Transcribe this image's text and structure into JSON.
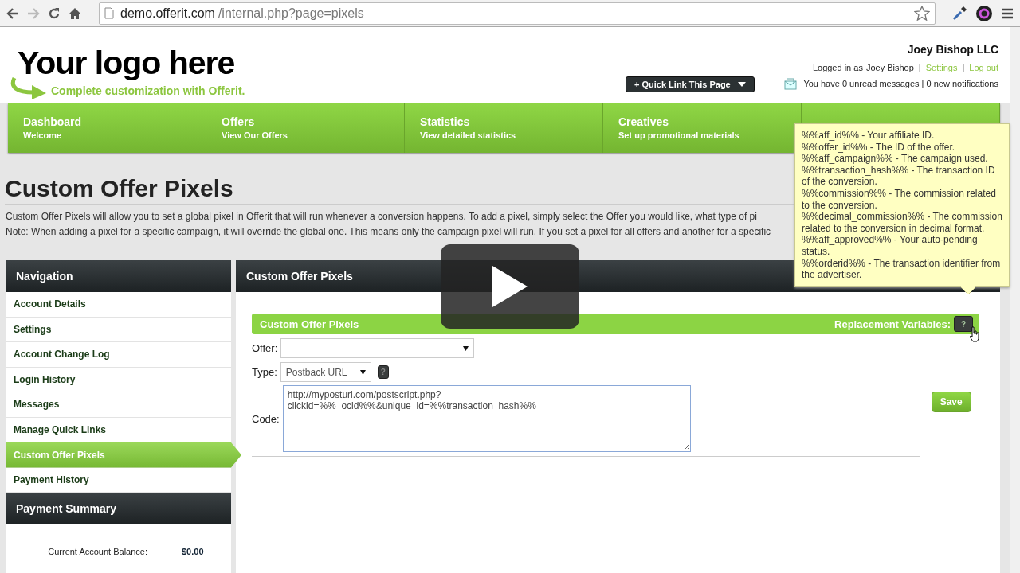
{
  "browser": {
    "url_host": "demo.offerit.com",
    "url_path": "/internal.php?page=pixels"
  },
  "header": {
    "logo": "Your logo here",
    "tagline": "Complete customization with Offerit.",
    "quick_link": "+ Quick Link This Page",
    "company": "Joey Bishop LLC",
    "logged_in_prefix": "Logged in as",
    "user": "Joey Bishop",
    "separator": "|",
    "links": [
      "Settings",
      "Log out"
    ],
    "messages": "You have 0 unread messages | 0 new notifications"
  },
  "nav_tabs": [
    {
      "title": "Dashboard",
      "subtitle": "Welcome"
    },
    {
      "title": "Offers",
      "subtitle": "View Our Offers"
    },
    {
      "title": "Statistics",
      "subtitle": "View detailed statistics"
    },
    {
      "title": "Creatives",
      "subtitle": "Set up promotional materials"
    }
  ],
  "page": {
    "title": "Custom Offer Pixels",
    "description": [
      "Custom Offer Pixels will allow you to set a global pixel in Offerit that will run whenever a conversion happens. To add a pixel, simply select the Offer you would like, what type of pi",
      "Note: When adding a pixel for a specific campaign, it will override the global one. This means only the campaign pixel will run. If you set a pixel for all offers and another for a specific"
    ]
  },
  "sidebar": {
    "title": "Navigation",
    "items": [
      {
        "label": "Account Details",
        "selected": false
      },
      {
        "label": "Settings",
        "selected": false
      },
      {
        "label": "Account Change Log",
        "selected": false
      },
      {
        "label": "Login History",
        "selected": false
      },
      {
        "label": "Messages",
        "selected": false
      },
      {
        "label": "Manage Quick Links",
        "selected": false
      },
      {
        "label": "Custom Offer Pixels",
        "selected": true
      },
      {
        "label": "Payment History",
        "selected": false
      }
    ],
    "summary_title": "Payment Summary",
    "summary": [
      {
        "label": "Current Account Balance:",
        "value": "$0.00"
      }
    ]
  },
  "panel": {
    "title": "Custom Offer Pixels",
    "section_title": "Custom Offer Pixels",
    "replacement_label": "Replacement Variables:",
    "help": "?",
    "offer_label": "Offer:",
    "type_label": "Type:",
    "type_value": "Postback URL",
    "type_help": "?",
    "code_label": "Code:",
    "code_value": "http://myposturl.com/postscript.php?\nclickid=%%_ocid%%&unique_id=%%transaction_hash%%",
    "save": "Save"
  },
  "tooltip": [
    "%%aff_id%% - Your affiliate ID.",
    "%%offer_id%% - The ID of the offer.",
    "%%aff_campaign%% - The campaign used.",
    "%%transaction_hash%% - The transaction ID of the conversion.",
    "%%commission%% - The commission related to the conversion.",
    "%%decimal_commission%% - The commission related to the conversion in decimal format.",
    "%%aff_approved%% - Your auto-pending status.",
    "%%orderid%% - The transaction identifier from the advertiser."
  ]
}
